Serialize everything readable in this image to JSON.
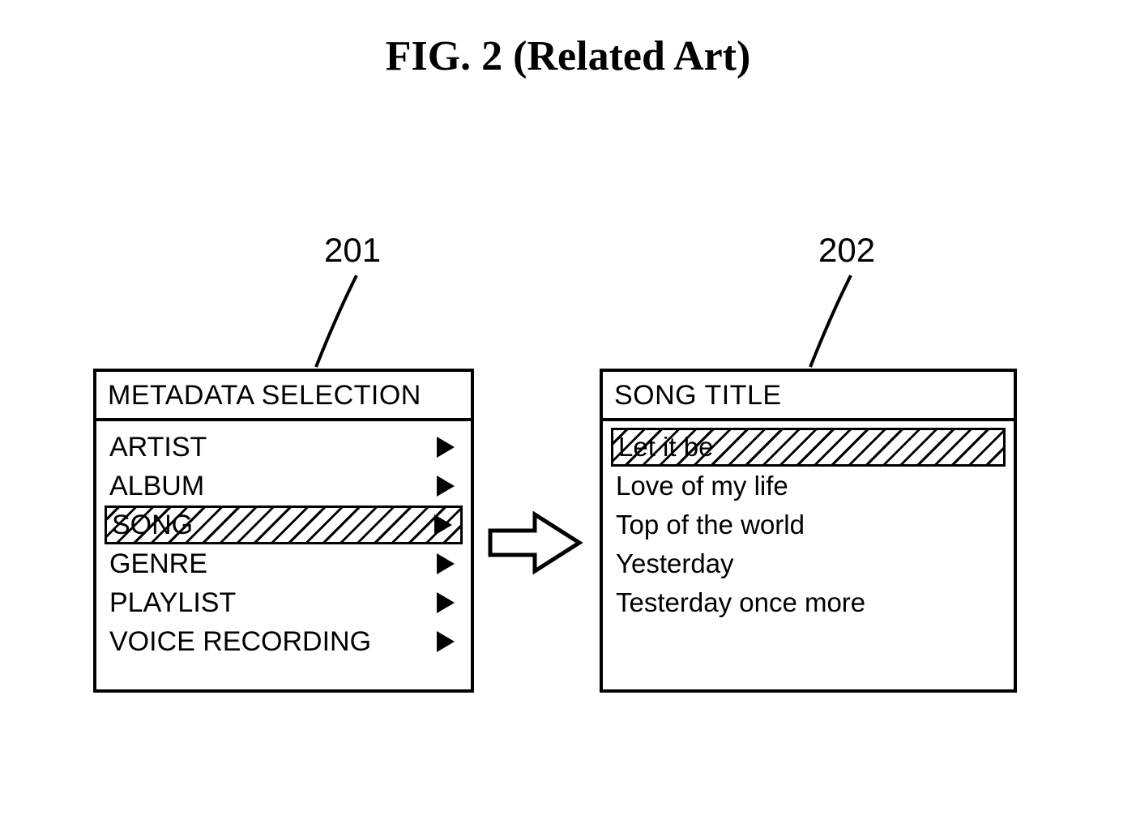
{
  "figure_title": "FIG. 2  (Related Art)",
  "refs": {
    "left": "201",
    "right": "202"
  },
  "left_panel": {
    "header": "METADATA SELECTION",
    "items": [
      {
        "label": "ARTIST",
        "selected": false
      },
      {
        "label": "ALBUM",
        "selected": false
      },
      {
        "label": "SONG",
        "selected": true
      },
      {
        "label": "GENRE",
        "selected": false
      },
      {
        "label": "PLAYLIST",
        "selected": false
      },
      {
        "label": "VOICE RECORDING",
        "selected": false
      }
    ]
  },
  "right_panel": {
    "header": "SONG TITLE",
    "items": [
      {
        "label": "Let it be",
        "selected": true
      },
      {
        "label": "Love of my life",
        "selected": false
      },
      {
        "label": "Top of the world",
        "selected": false
      },
      {
        "label": "Yesterday",
        "selected": false
      },
      {
        "label": "Testerday once more",
        "selected": false
      }
    ]
  }
}
